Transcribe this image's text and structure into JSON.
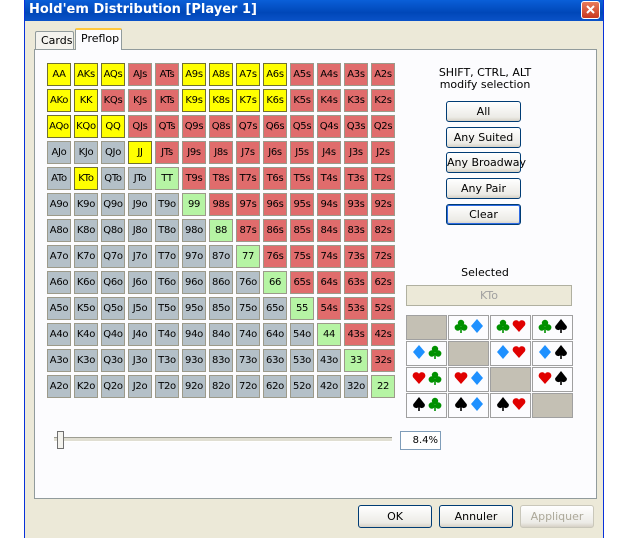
{
  "window": {
    "title": "Hold'em Distribution [Player 1]"
  },
  "tabs": [
    {
      "label": "Cards"
    },
    {
      "label": "Preflop",
      "active": true
    }
  ],
  "grid": {
    "rows": [
      [
        "AA",
        "AKs",
        "AQs",
        "AJs",
        "ATs",
        "A9s",
        "A8s",
        "A7s",
        "A6s",
        "A5s",
        "A4s",
        "A3s",
        "A2s"
      ],
      [
        "AKo",
        "KK",
        "KQs",
        "KJs",
        "KTs",
        "K9s",
        "K8s",
        "K7s",
        "K6s",
        "K5s",
        "K4s",
        "K3s",
        "K2s"
      ],
      [
        "AQo",
        "KQo",
        "QQ",
        "QJs",
        "QTs",
        "Q9s",
        "Q8s",
        "Q7s",
        "Q6s",
        "Q5s",
        "Q4s",
        "Q3s",
        "Q2s"
      ],
      [
        "AJo",
        "KJo",
        "QJo",
        "JJ",
        "JTs",
        "J9s",
        "J8s",
        "J7s",
        "J6s",
        "J5s",
        "J4s",
        "J3s",
        "J2s"
      ],
      [
        "ATo",
        "KTo",
        "QTo",
        "JTo",
        "TT",
        "T9s",
        "T8s",
        "T7s",
        "T6s",
        "T5s",
        "T4s",
        "T3s",
        "T2s"
      ],
      [
        "A9o",
        "K9o",
        "Q9o",
        "J9o",
        "T9o",
        "99",
        "98s",
        "97s",
        "96s",
        "95s",
        "94s",
        "93s",
        "92s"
      ],
      [
        "A8o",
        "K8o",
        "Q8o",
        "J8o",
        "T8o",
        "98o",
        "88",
        "87s",
        "86s",
        "85s",
        "84s",
        "83s",
        "82s"
      ],
      [
        "A7o",
        "K7o",
        "Q7o",
        "J7o",
        "T7o",
        "97o",
        "87o",
        "77",
        "76s",
        "75s",
        "74s",
        "73s",
        "72s"
      ],
      [
        "A6o",
        "K6o",
        "Q6o",
        "J6o",
        "T6o",
        "96o",
        "86o",
        "76o",
        "66",
        "65s",
        "64s",
        "63s",
        "62s"
      ],
      [
        "A5o",
        "K5o",
        "Q5o",
        "J5o",
        "T5o",
        "95o",
        "85o",
        "75o",
        "65o",
        "55",
        "54s",
        "53s",
        "52s"
      ],
      [
        "A4o",
        "K4o",
        "Q4o",
        "J4o",
        "T4o",
        "94o",
        "84o",
        "74o",
        "64o",
        "54o",
        "44",
        "43s",
        "42s"
      ],
      [
        "A3o",
        "K3o",
        "Q3o",
        "J3o",
        "T3o",
        "93o",
        "83o",
        "73o",
        "63o",
        "53o",
        "43o",
        "33",
        "32s"
      ],
      [
        "A2o",
        "K2o",
        "Q2o",
        "J2o",
        "T2o",
        "92o",
        "82o",
        "72o",
        "62o",
        "52o",
        "42o",
        "32o",
        "22"
      ]
    ],
    "selected": [
      "AA",
      "AKs",
      "AQs",
      "A9s",
      "A8s",
      "A7s",
      "A6s",
      "AKo",
      "KK",
      "K9s",
      "K8s",
      "K7s",
      "K6s",
      "AQo",
      "KQo",
      "QQ",
      "JJ",
      "KTo"
    ],
    "colors": {
      "selected": "#ffff00",
      "suited": "#e06c6c",
      "offsuit": "#b4c0c8",
      "pair": "#b6f4a4"
    }
  },
  "modifiers": {
    "line1": "SHIFT, CTRL, ALT",
    "line2": "modify selection"
  },
  "buttons": {
    "all": "All",
    "any_suited": "Any Suited",
    "any_broadway": "Any Broadway",
    "any_pair": "Any Pair",
    "clear": "Clear"
  },
  "selected_hand": {
    "label": "Selected",
    "value": "KTo"
  },
  "suit_combos": [
    [
      null,
      [
        "club",
        "diamond"
      ],
      [
        "club",
        "heart"
      ],
      [
        "club",
        "spade"
      ]
    ],
    [
      [
        "diamond",
        "club"
      ],
      null,
      [
        "diamond",
        "heart"
      ],
      [
        "diamond",
        "spade"
      ]
    ],
    [
      [
        "heart",
        "club"
      ],
      [
        "heart",
        "diamond"
      ],
      null,
      [
        "heart",
        "spade"
      ]
    ],
    [
      [
        "spade",
        "club"
      ],
      [
        "spade",
        "diamond"
      ],
      [
        "spade",
        "heart"
      ],
      null
    ]
  ],
  "suit_colors": {
    "club": "#009000",
    "diamond": "#1e90ff",
    "heart": "#e00000",
    "spade": "#000000"
  },
  "slider": {
    "value": "8.4%",
    "fraction": 0.084
  },
  "footer": {
    "ok": "OK",
    "cancel": "Annuler",
    "apply": "Appliquer"
  }
}
